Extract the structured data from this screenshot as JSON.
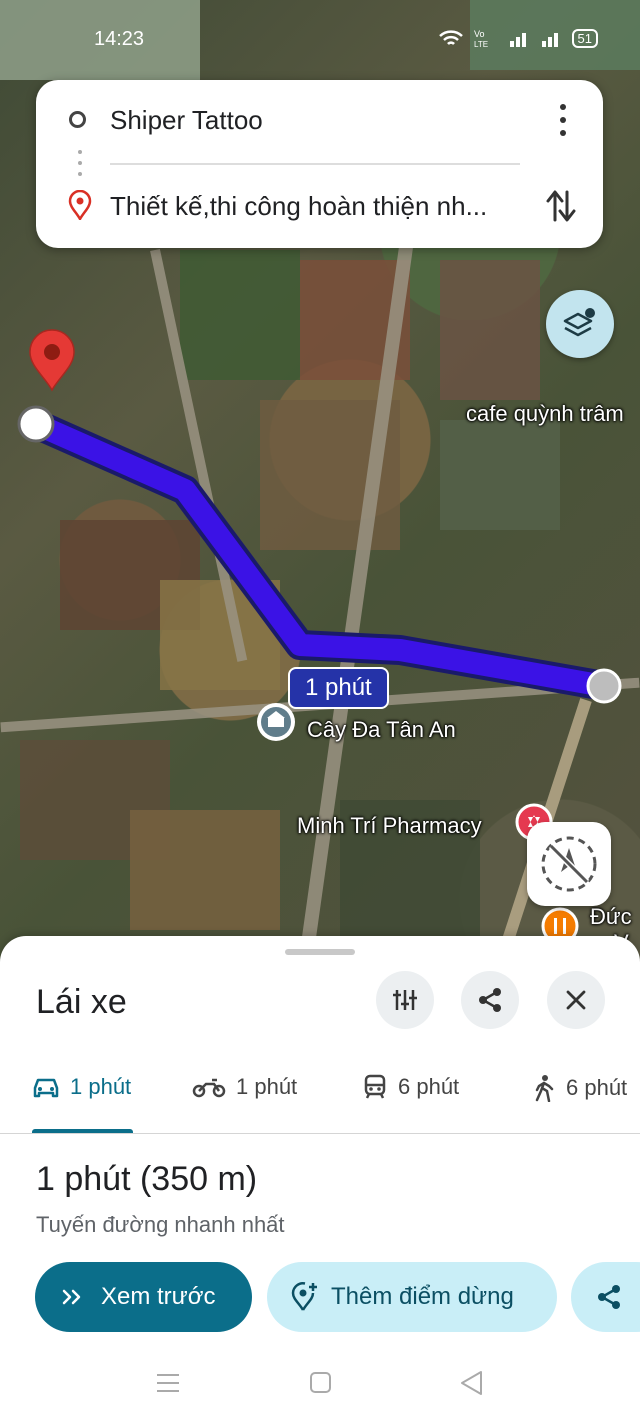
{
  "status_bar": {
    "time": "14:23",
    "battery": "51"
  },
  "directions": {
    "origin": "Shiper Tattoo",
    "destination": "Thiết kế,thi công hoàn thiện nh..."
  },
  "map": {
    "labels": {
      "cafe": "cafe quỳnh trâm",
      "landmark": "Cây Đa Tân An",
      "pharmacy": "Minh Trí Pharmacy",
      "partial": "Đức",
      "partial2": "V"
    },
    "route_time_chip": "1 phút",
    "colors": {
      "route": "#3b12e6",
      "chip": "#2533a8"
    }
  },
  "sheet": {
    "title": "Lái xe",
    "tabs": [
      {
        "icon": "car-icon",
        "label": "1 phút"
      },
      {
        "icon": "motorbike-icon",
        "label": "1 phút"
      },
      {
        "icon": "transit-icon",
        "label": "6 phút"
      },
      {
        "icon": "walk-icon",
        "label": "6 phút"
      }
    ],
    "summary": "1 phút (350 m)",
    "summary_sub": "Tuyến đường nhanh nhất",
    "buttons": {
      "preview": "Xem trước",
      "add_stop": "Thêm điểm dừng"
    },
    "colors": {
      "accent": "#0b6e8a",
      "secondary_pill": "#c9eef7"
    }
  }
}
